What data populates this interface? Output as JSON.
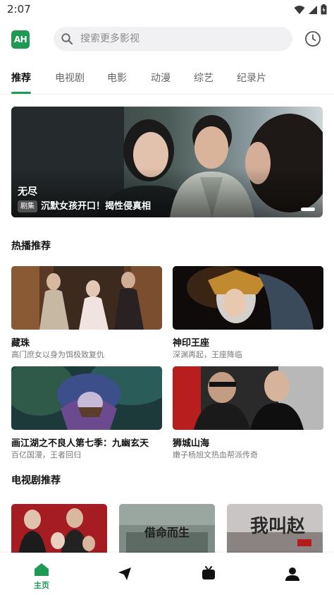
{
  "status_bar": {
    "time": "2:07"
  },
  "header": {
    "logo_text": "AH",
    "search_placeholder": "搜索更多影视"
  },
  "tabs": [
    {
      "label": "推荐",
      "active": true
    },
    {
      "label": "电视剧",
      "active": false
    },
    {
      "label": "电影",
      "active": false
    },
    {
      "label": "动漫",
      "active": false
    },
    {
      "label": "综艺",
      "active": false
    },
    {
      "label": "纪录片",
      "active": false
    }
  ],
  "banner": {
    "title": "无尽",
    "badge": "剧集",
    "subtitle": "沉默女孩开口！揭性侵真相"
  },
  "hot_section": {
    "title": "热播推荐",
    "items": [
      {
        "title": "藏珠",
        "desc": "高门庶女以身为饵极致复仇"
      },
      {
        "title": "神印王座",
        "desc": "深渊再起，王座降临"
      },
      {
        "title": "画江湖之不良人第七季：九幽玄天",
        "desc": "百亿国漫，王者回归"
      },
      {
        "title": "狮城山海",
        "desc": "嫩子杨旭文热血帮派传奇"
      }
    ]
  },
  "tv_section": {
    "title": "电视剧推荐",
    "poster_texts": [
      "借命而生",
      "我叫赵"
    ]
  },
  "bottom_nav": [
    {
      "label": "主页",
      "icon": "home-icon",
      "active": true
    },
    {
      "label": "",
      "icon": "send-icon",
      "active": false
    },
    {
      "label": "",
      "icon": "tv-icon",
      "active": false
    },
    {
      "label": "",
      "icon": "user-icon",
      "active": false
    }
  ],
  "colors": {
    "accent": "#1f9a55"
  }
}
